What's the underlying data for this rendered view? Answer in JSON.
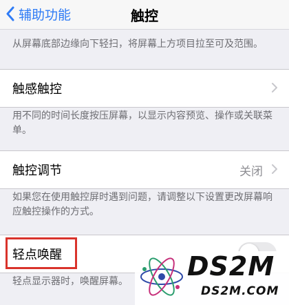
{
  "nav": {
    "back_label": "辅助功能",
    "title": "触控"
  },
  "notes": {
    "swipe": "从屏幕底部边缘向下轻扫，将屏幕上方项目拉至可及范围。",
    "haptic": "用不同的时间长度按压屏幕，以显示内容预览、操作或关联菜单。",
    "touch_accommodations": "如果您在使用触控屏时遇到问题，请调整以下设置更改屏幕响应触控操作的方式。",
    "tap_to_wake": "轻点显示器时，唤醒屏幕。"
  },
  "cells": {
    "haptic_touch": {
      "label": "触感触控"
    },
    "touch_accommodations": {
      "label": "触控调节",
      "value": "关闭"
    },
    "tap_to_wake": {
      "label": "轻点唤醒",
      "toggle_state": "off"
    }
  },
  "watermark": {
    "text": "DS2M",
    "sub": "DS2M.COM"
  },
  "colors": {
    "accent": "#2f7cf6",
    "highlight": "#d9332b",
    "background": "#efeff4"
  }
}
